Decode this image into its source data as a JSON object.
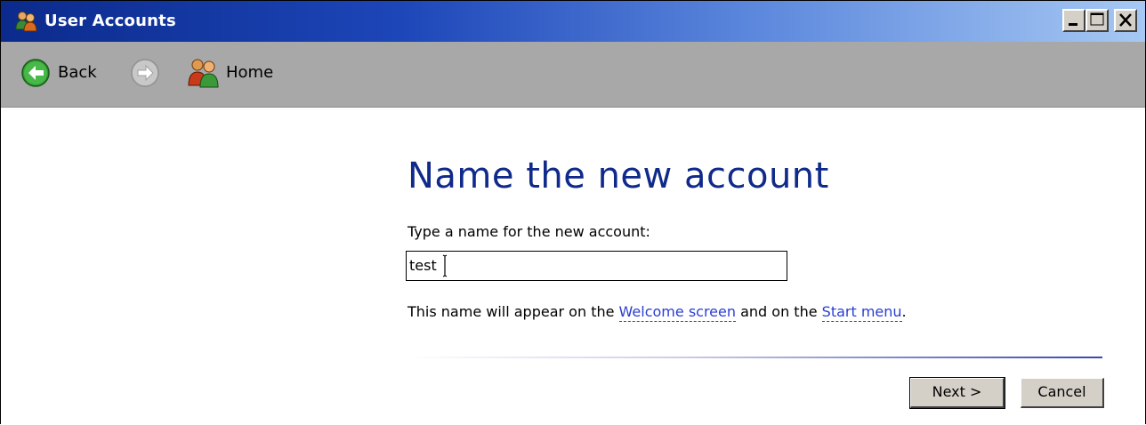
{
  "window": {
    "title": "User Accounts",
    "title_icon": "users-icon",
    "controls": [
      "minimize-icon",
      "maximize-icon",
      "close-icon"
    ]
  },
  "toolbar": {
    "back_label": "Back",
    "back_icon": "back-arrow-icon",
    "forward_icon": "forward-arrow-icon",
    "home_label": "Home",
    "home_icon": "users-home-icon"
  },
  "main": {
    "heading": "Name the new account",
    "prompt": "Type a name for the new account:",
    "name_value": "test",
    "info_prefix": "This name will appear on the ",
    "info_link1": "Welcome screen",
    "info_middle": " and on the ",
    "info_link2": "Start menu",
    "info_suffix": "."
  },
  "buttons": {
    "next": "Next >",
    "cancel": "Cancel"
  },
  "colors": {
    "title_bar_start": "#0b2a8c",
    "title_bar_end": "#a6c8f3",
    "heading": "#0f2a8a",
    "link": "#2a3fd0",
    "toolbar_bg": "#a8a8a8"
  }
}
